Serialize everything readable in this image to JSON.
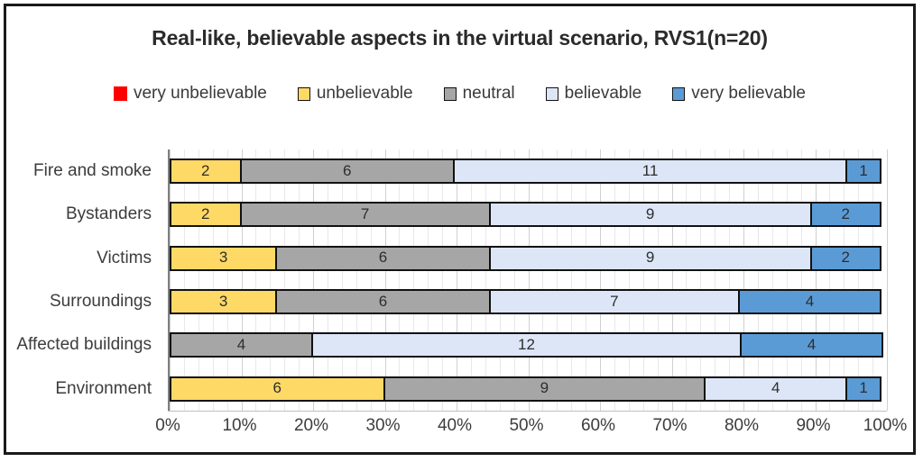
{
  "chart_data": {
    "type": "bar",
    "subtype": "horizontal-stacked-100percent",
    "title": "Real-like, believable aspects in the virtual scenario, RVS1(n=20)",
    "xlabel": "",
    "ylabel": "",
    "xlim": [
      0,
      100
    ],
    "xticks": [
      "0%",
      "10%",
      "20%",
      "30%",
      "40%",
      "50%",
      "60%",
      "70%",
      "80%",
      "90%",
      "100%"
    ],
    "grid": true,
    "minor_grid": true,
    "legend_position": "top",
    "total_respondents": 20,
    "categories": [
      "Fire and smoke",
      "Bystanders",
      "Victims",
      "Surroundings",
      "Affected buildings",
      "Environment"
    ],
    "series": [
      {
        "name": "very unbelievable",
        "color": "#FF0000",
        "values": [
          0,
          0,
          0,
          0,
          0,
          0
        ]
      },
      {
        "name": "unbelievable",
        "color": "#FFD966",
        "values": [
          2,
          2,
          3,
          3,
          0,
          6
        ]
      },
      {
        "name": "neutral",
        "color": "#A6A6A6",
        "values": [
          6,
          7,
          6,
          6,
          4,
          9
        ]
      },
      {
        "name": "believable",
        "color": "#DCE6F7",
        "values": [
          11,
          9,
          9,
          7,
          12,
          4
        ]
      },
      {
        "name": "very believable",
        "color": "#5B9BD5",
        "values": [
          1,
          2,
          2,
          4,
          4,
          1
        ]
      }
    ],
    "bar_labels": [
      [
        "",
        "2",
        "6",
        "11",
        "1"
      ],
      [
        "",
        "2",
        "7",
        "9",
        "2"
      ],
      [
        "",
        "3",
        "6",
        "9",
        "2"
      ],
      [
        "",
        "3",
        "6",
        "7",
        "4"
      ],
      [
        "",
        "",
        "4",
        "12",
        "4"
      ],
      [
        "",
        "6",
        "9",
        "4",
        "1"
      ]
    ]
  },
  "legend": {
    "items": [
      {
        "label": "very unbelievable",
        "color": "#FF0000",
        "bordered": false
      },
      {
        "label": "unbelievable",
        "color": "#FFD966",
        "bordered": true
      },
      {
        "label": "neutral",
        "color": "#A6A6A6",
        "bordered": true
      },
      {
        "label": "believable",
        "color": "#DCE6F7",
        "bordered": true
      },
      {
        "label": "very believable",
        "color": "#5B9BD5",
        "bordered": true
      }
    ]
  }
}
